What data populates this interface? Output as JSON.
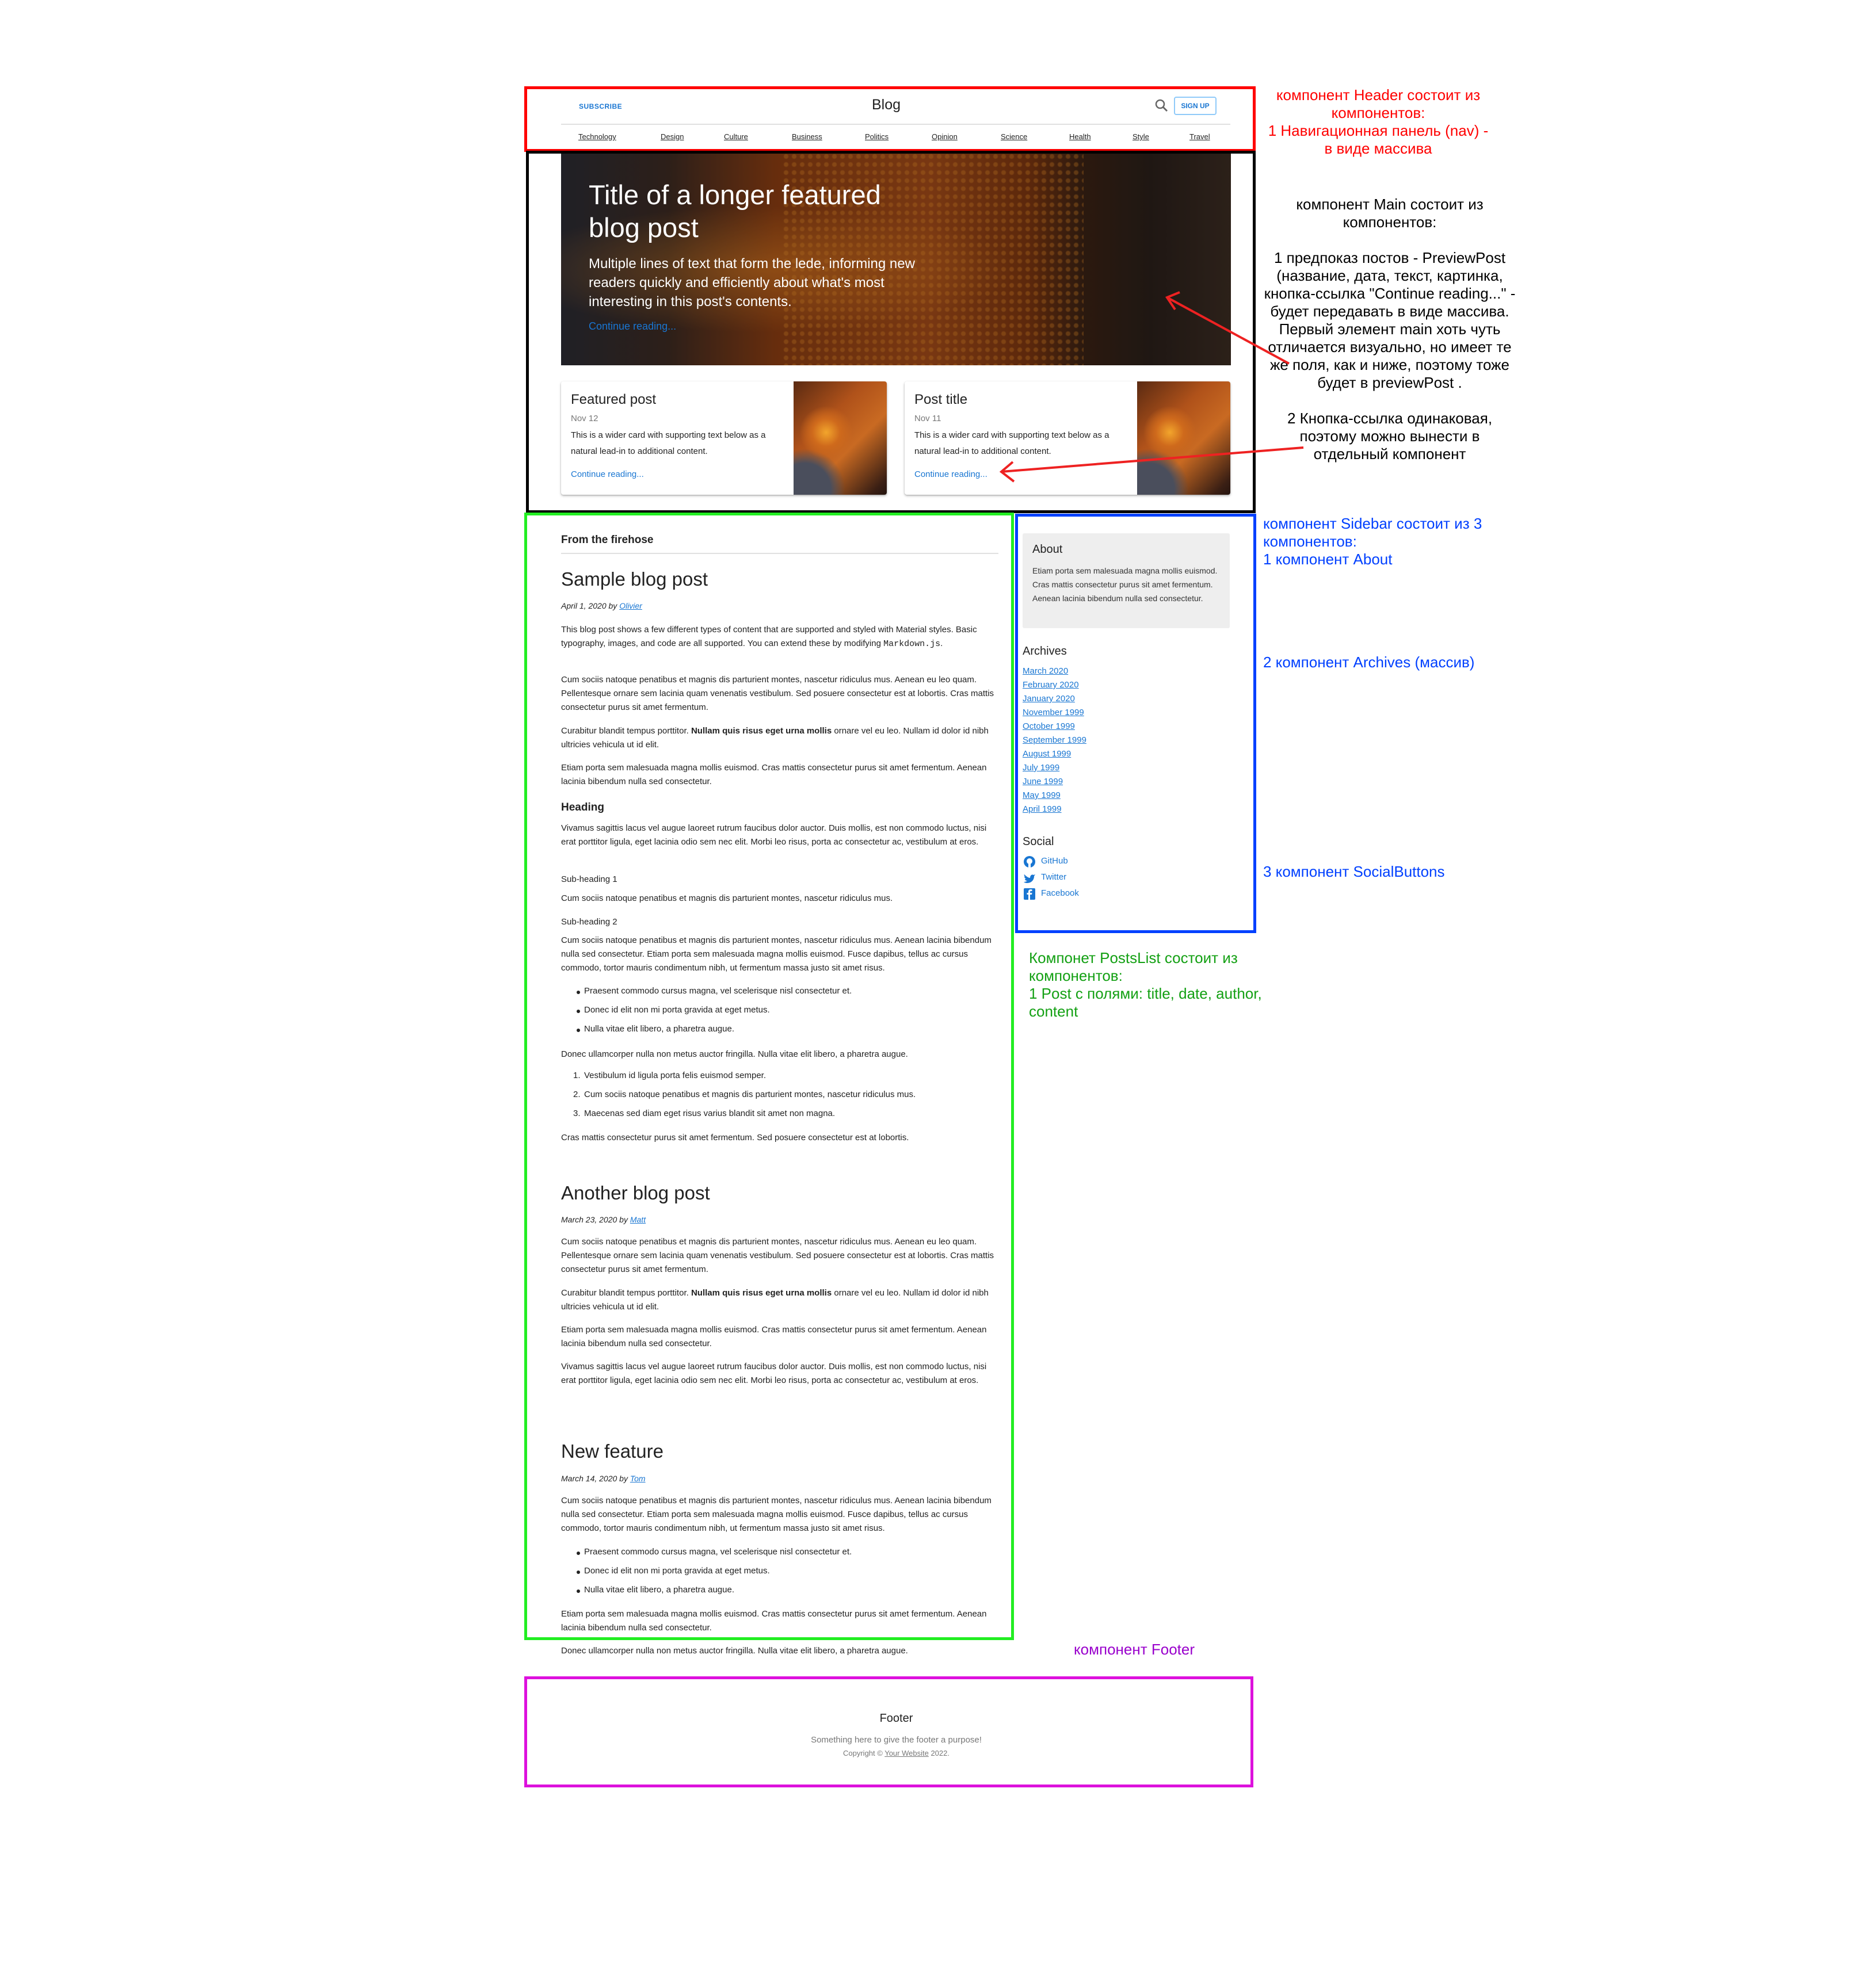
{
  "header": {
    "subscribe": "SUBSCRIBE",
    "title": "Blog",
    "signup": "SIGN UP",
    "nav": [
      "Technology",
      "Design",
      "Culture",
      "Business",
      "Politics",
      "Opinion",
      "Science",
      "Health",
      "Style",
      "Travel"
    ]
  },
  "hero": {
    "title": "Title of a longer featured blog post",
    "text": "Multiple lines of text that form the lede, informing new readers quickly and efficiently about what's most interesting in this post's contents.",
    "link": "Continue reading..."
  },
  "cards": [
    {
      "title": "Featured post",
      "date": "Nov 12",
      "text": "This is a wider card with supporting text below as a natural lead-in to additional content.",
      "link": "Continue reading..."
    },
    {
      "title": "Post title",
      "date": "Nov 11",
      "text": "This is a wider card with supporting text below as a natural lead-in to additional content.",
      "link": "Continue reading..."
    }
  ],
  "posts": {
    "section_title": "From the firehose",
    "p1": {
      "title": "Sample blog post",
      "date": "April 1, 2020 by",
      "author": "Olivier",
      "intro": "This blog post shows a few different types of content that are supported and styled with Material styles. Basic typography, images, and code are all supported. You can extend these by modifying",
      "intro_code": "Markdown.js",
      "para1": "Cum sociis natoque penatibus et magnis dis parturient montes, nascetur ridiculus mus. Aenean eu leo quam. Pellentesque ornare sem lacinia quam venenatis vestibulum. Sed posuere consectetur est at lobortis. Cras mattis consectetur purus sit amet fermentum.",
      "para2_a": "Curabitur blandit tempus porttitor.",
      "para2_b": "Nullam quis risus eget urna mollis",
      "para2_c": "ornare vel eu leo. Nullam id dolor id nibh ultricies vehicula ut id elit.",
      "para3": "Etiam porta sem malesuada magna mollis euismod. Cras mattis consectetur purus sit amet fermentum. Aenean lacinia bibendum nulla sed consectetur.",
      "heading": "Heading",
      "para4": "Vivamus sagittis lacus vel augue laoreet rutrum faucibus dolor auctor. Duis mollis, est non commodo luctus, nisi erat porttitor ligula, eget lacinia odio sem nec elit. Morbi leo risus, porta ac consectetur ac, vestibulum at eros.",
      "sub1": "Sub-heading 1",
      "para5": "Cum sociis natoque penatibus et magnis dis parturient montes, nascetur ridiculus mus.",
      "sub2": "Sub-heading 2",
      "para6": "Cum sociis natoque penatibus et magnis dis parturient montes, nascetur ridiculus mus. Aenean lacinia bibendum nulla sed consectetur. Etiam porta sem malesuada magna mollis euismod. Fusce dapibus, tellus ac cursus commodo, tortor mauris condimentum nibh, ut fermentum massa justo sit amet risus.",
      "bullets": [
        "Praesent commodo cursus magna, vel scelerisque nisl consectetur et.",
        "Donec id elit non mi porta gravida at eget metus.",
        "Nulla vitae elit libero, a pharetra augue."
      ],
      "para7": "Donec ullamcorper nulla non metus auctor fringilla. Nulla vitae elit libero, a pharetra augue.",
      "ordered": [
        "Vestibulum id ligula porta felis euismod semper.",
        "Cum sociis natoque penatibus et magnis dis parturient montes, nascetur ridiculus mus.",
        "Maecenas sed diam eget risus varius blandit sit amet non magna."
      ],
      "para8": "Cras mattis consectetur purus sit amet fermentum. Sed posuere consectetur est at lobortis."
    },
    "p2": {
      "title": "Another blog post",
      "date": "March 23, 2020 by",
      "author": "Matt",
      "para1": "Cum sociis natoque penatibus et magnis dis parturient montes, nascetur ridiculus mus. Aenean eu leo quam. Pellentesque ornare sem lacinia quam venenatis vestibulum. Sed posuere consectetur est at lobortis. Cras mattis consectetur purus sit amet fermentum.",
      "para2_a": "Curabitur blandit tempus porttitor.",
      "para2_b": "Nullam quis risus eget urna mollis",
      "para2_c": "ornare vel eu leo. Nullam id dolor id nibh ultricies vehicula ut id elit.",
      "para3": "Etiam porta sem malesuada magna mollis euismod. Cras mattis consectetur purus sit amet fermentum. Aenean lacinia bibendum nulla sed consectetur.",
      "para4": "Vivamus sagittis lacus vel augue laoreet rutrum faucibus dolor auctor. Duis mollis, est non commodo luctus, nisi erat porttitor ligula, eget lacinia odio sem nec elit. Morbi leo risus, porta ac consectetur ac, vestibulum at eros."
    },
    "p3": {
      "title": "New feature",
      "date": "March 14, 2020 by",
      "author": "Tom",
      "para1": "Cum sociis natoque penatibus et magnis dis parturient montes, nascetur ridiculus mus. Aenean lacinia bibendum nulla sed consectetur. Etiam porta sem malesuada magna mollis euismod. Fusce dapibus, tellus ac cursus commodo, tortor mauris condimentum nibh, ut fermentum massa justo sit amet risus.",
      "bullets": [
        "Praesent commodo cursus magna, vel scelerisque nisl consectetur et.",
        "Donec id elit non mi porta gravida at eget metus.",
        "Nulla vitae elit libero, a pharetra augue."
      ],
      "para2": "Etiam porta sem malesuada magna mollis euismod. Cras mattis consectetur purus sit amet fermentum. Aenean lacinia bibendum nulla sed consectetur.",
      "para3": "Donec ullamcorper nulla non metus auctor fringilla. Nulla vitae elit libero, a pharetra augue."
    }
  },
  "sidebar": {
    "about_title": "About",
    "about_text": "Etiam porta sem malesuada magna mollis euismod. Cras mattis consectetur purus sit amet fermentum. Aenean lacinia bibendum nulla sed consectetur.",
    "archives_title": "Archives",
    "archives": [
      "March 2020",
      "February 2020",
      "January 2020",
      "November 1999",
      "October 1999",
      "September 1999",
      "August 1999",
      "July 1999",
      "June 1999",
      "May 1999",
      "April 1999"
    ],
    "social_title": "Social",
    "social": [
      {
        "name": "GitHub",
        "icon": "github-icon"
      },
      {
        "name": "Twitter",
        "icon": "twitter-icon"
      },
      {
        "name": "Facebook",
        "icon": "facebook-icon"
      }
    ]
  },
  "footer": {
    "title": "Footer",
    "text": "Something here to give the footer a purpose!",
    "copy_prefix": "Copyright ©",
    "copy_link": "Your Website",
    "copy_year": "2022."
  },
  "annotations": {
    "header": "компонент Header состоит из компонентов:",
    "header_nav": "1 Навигационная панель (nav) - в виде массива",
    "main_title": "компонент Main состоит из компонентов:",
    "main_1": "1 предпоказ постов - PreviewPost (название, дата, текст, картинка, кнопка-ссылка \"Continue reading...\" - будет передавать в виде массива.",
    "main_1b": "Первый элемент main хоть чуть отличается визуально, но имеет те же поля, как и ниже, поэтому тоже будет в previewPost .",
    "main_2": "2 Кнопка-ссылка одинаковая, поэтому можно вынести в отдельный компонент",
    "sidebar_title": "компонент Sidebar состоит из 3 компонентов:",
    "sidebar_1": "1 компонент About",
    "sidebar_2": "2 компонент Archives (массив)",
    "sidebar_3": "3 компонент SocialButtons",
    "posts_title": "Компонет PostsList состоит из компонентов:",
    "posts_1": "1 Post с полями: title, date, author, content",
    "footer": "компонент Footer",
    "colors": {
      "red": "#ff0000",
      "black": "#000000",
      "green": "#22ee22",
      "blue": "#0040ff",
      "magenta": "#dd11dd",
      "purple": "#9900cc",
      "link": "#1976d2"
    }
  }
}
